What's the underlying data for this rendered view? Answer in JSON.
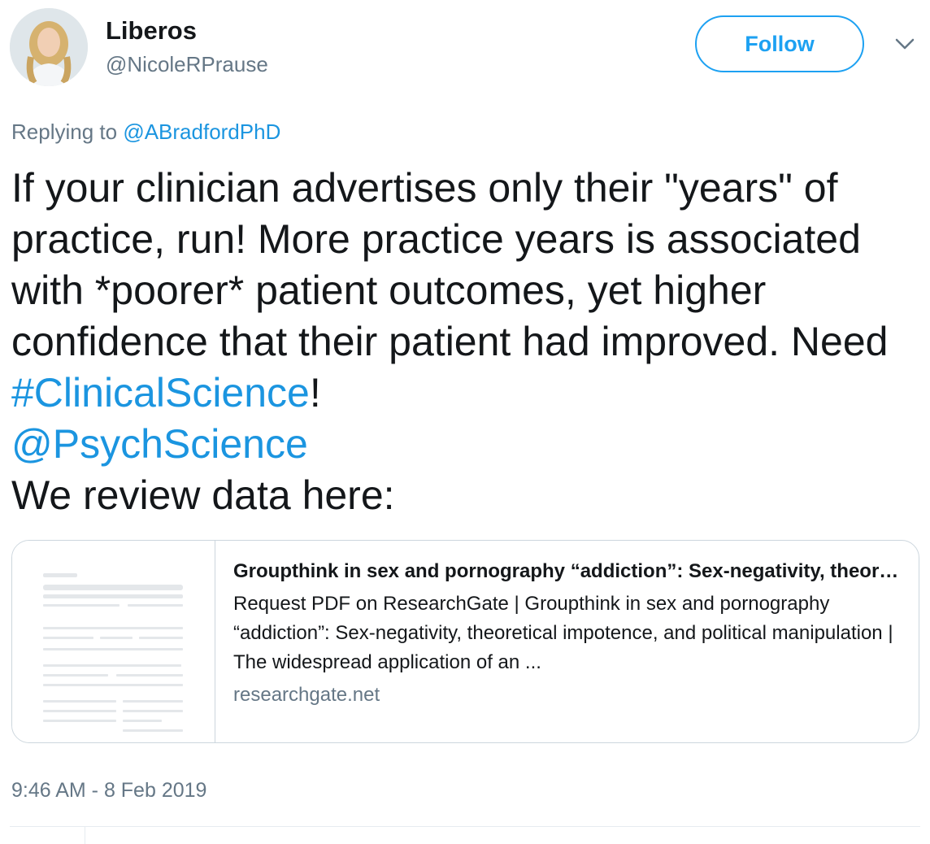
{
  "user": {
    "name": "Liberos",
    "handle": "@NicoleRPrause",
    "avatar_icon": "profile-photo"
  },
  "follow": {
    "label": "Follow",
    "color": "#1da1f2"
  },
  "menu": {
    "icon": "chevron-down-icon"
  },
  "reply": {
    "prefix": "Replying to ",
    "mention": "@ABradfordPhD"
  },
  "tweet": {
    "text_1": "If your clinician advertises only their \"years\" of practice, run! More practice years is associated with *poorer* patient outcomes, yet higher confidence that their patient had improved. Need ",
    "hashtag": "#ClinicalScience",
    "text_2": "!",
    "mention": "@PsychScience",
    "text_3": "We review data here:"
  },
  "card": {
    "thumbnail_icon": "document-thumbnail-icon",
    "title": "Groupthink in sex and pornography “addiction”: Sex-negativity, theoretical impotence, and political manipulation",
    "description": "Request PDF on ResearchGate | Groupthink in sex and pornography “addiction”: Sex-negativity, theoretical impotence, and political manipulation | The widespread application of an ...",
    "domain": "researchgate.net"
  },
  "timestamp": "9:46 AM - 8 Feb 2019",
  "colors": {
    "link": "#1b95e0",
    "text": "#14171a",
    "secondary": "#657786",
    "border": "#ccd6dd"
  }
}
